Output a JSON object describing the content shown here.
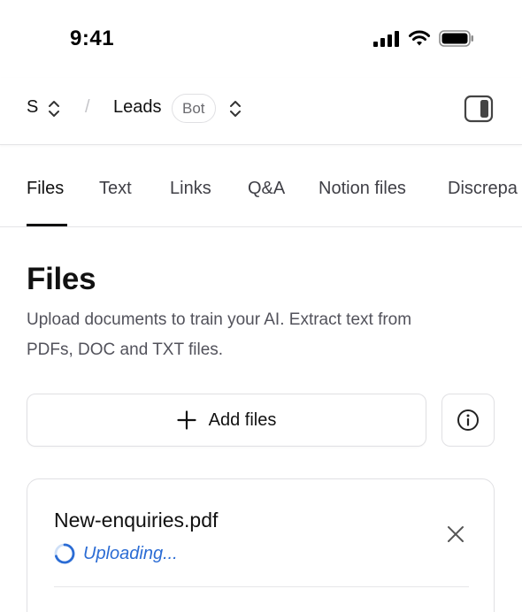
{
  "status_bar": {
    "time": "9:41",
    "icons": [
      "cellular-signal-icon",
      "wifi-icon",
      "battery-icon"
    ]
  },
  "header": {
    "workspace": {
      "label": "S",
      "switch_icon": "chevron-up-down-icon"
    },
    "separator": "/",
    "bot": {
      "name": "Leads",
      "badge": "Bot",
      "switch_icon": "chevron-up-down-icon"
    },
    "panel_toggle_icon": "sidebar-right-icon"
  },
  "tabs": [
    {
      "label": "Files",
      "active": true
    },
    {
      "label": "Text",
      "active": false
    },
    {
      "label": "Links",
      "active": false
    },
    {
      "label": "Q&A",
      "active": false
    },
    {
      "label": "Notion files",
      "active": false
    },
    {
      "label": "Discrepa",
      "active": false
    }
  ],
  "main": {
    "title": "Files",
    "description_line1": "Upload documents to train your AI. Extract text from",
    "description_line2": "PDFs, DOC and TXT files.",
    "add_files_label": "Add files",
    "add_icon": "plus-icon",
    "info_icon": "info-icon"
  },
  "files": [
    {
      "name": "New-enquiries.pdf",
      "status": "Uploading...",
      "status_icon": "spinner-icon",
      "remove_icon": "close-icon"
    }
  ],
  "colors": {
    "text_primary": "#111111",
    "text_secondary": "#52525b",
    "accent_blue": "#2b6cd4",
    "border": "#e0e0e3"
  }
}
